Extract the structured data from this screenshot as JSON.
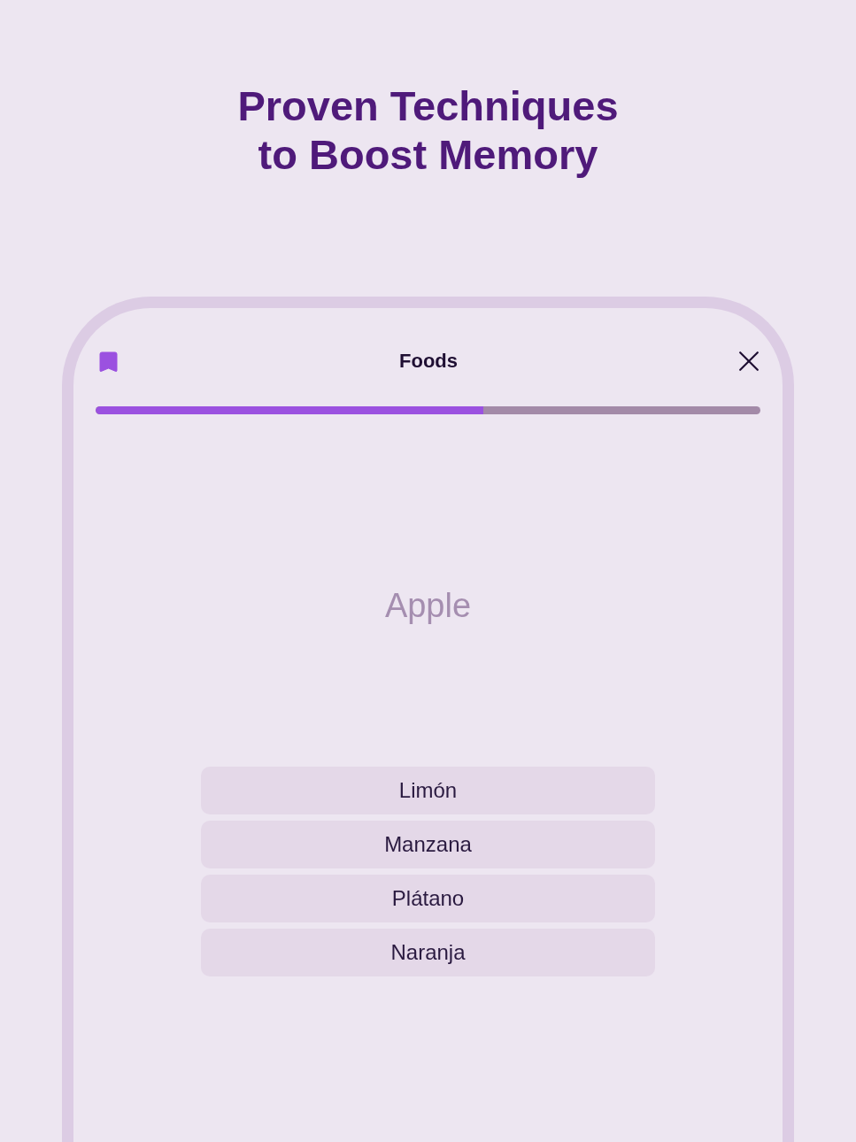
{
  "title": "Proven Techniques to Boost Memory",
  "quiz": {
    "bookmarked": true,
    "deck_title": "Foods",
    "progress": {
      "level": 0.583
    },
    "word": "Apple",
    "options": [
      {
        "label": "Limón",
        "selected": false
      },
      {
        "label": "Manzana",
        "selected": false
      },
      {
        "label": "Plátano",
        "selected": false
      },
      {
        "label": "Naranja",
        "selected": false
      }
    ]
  }
}
